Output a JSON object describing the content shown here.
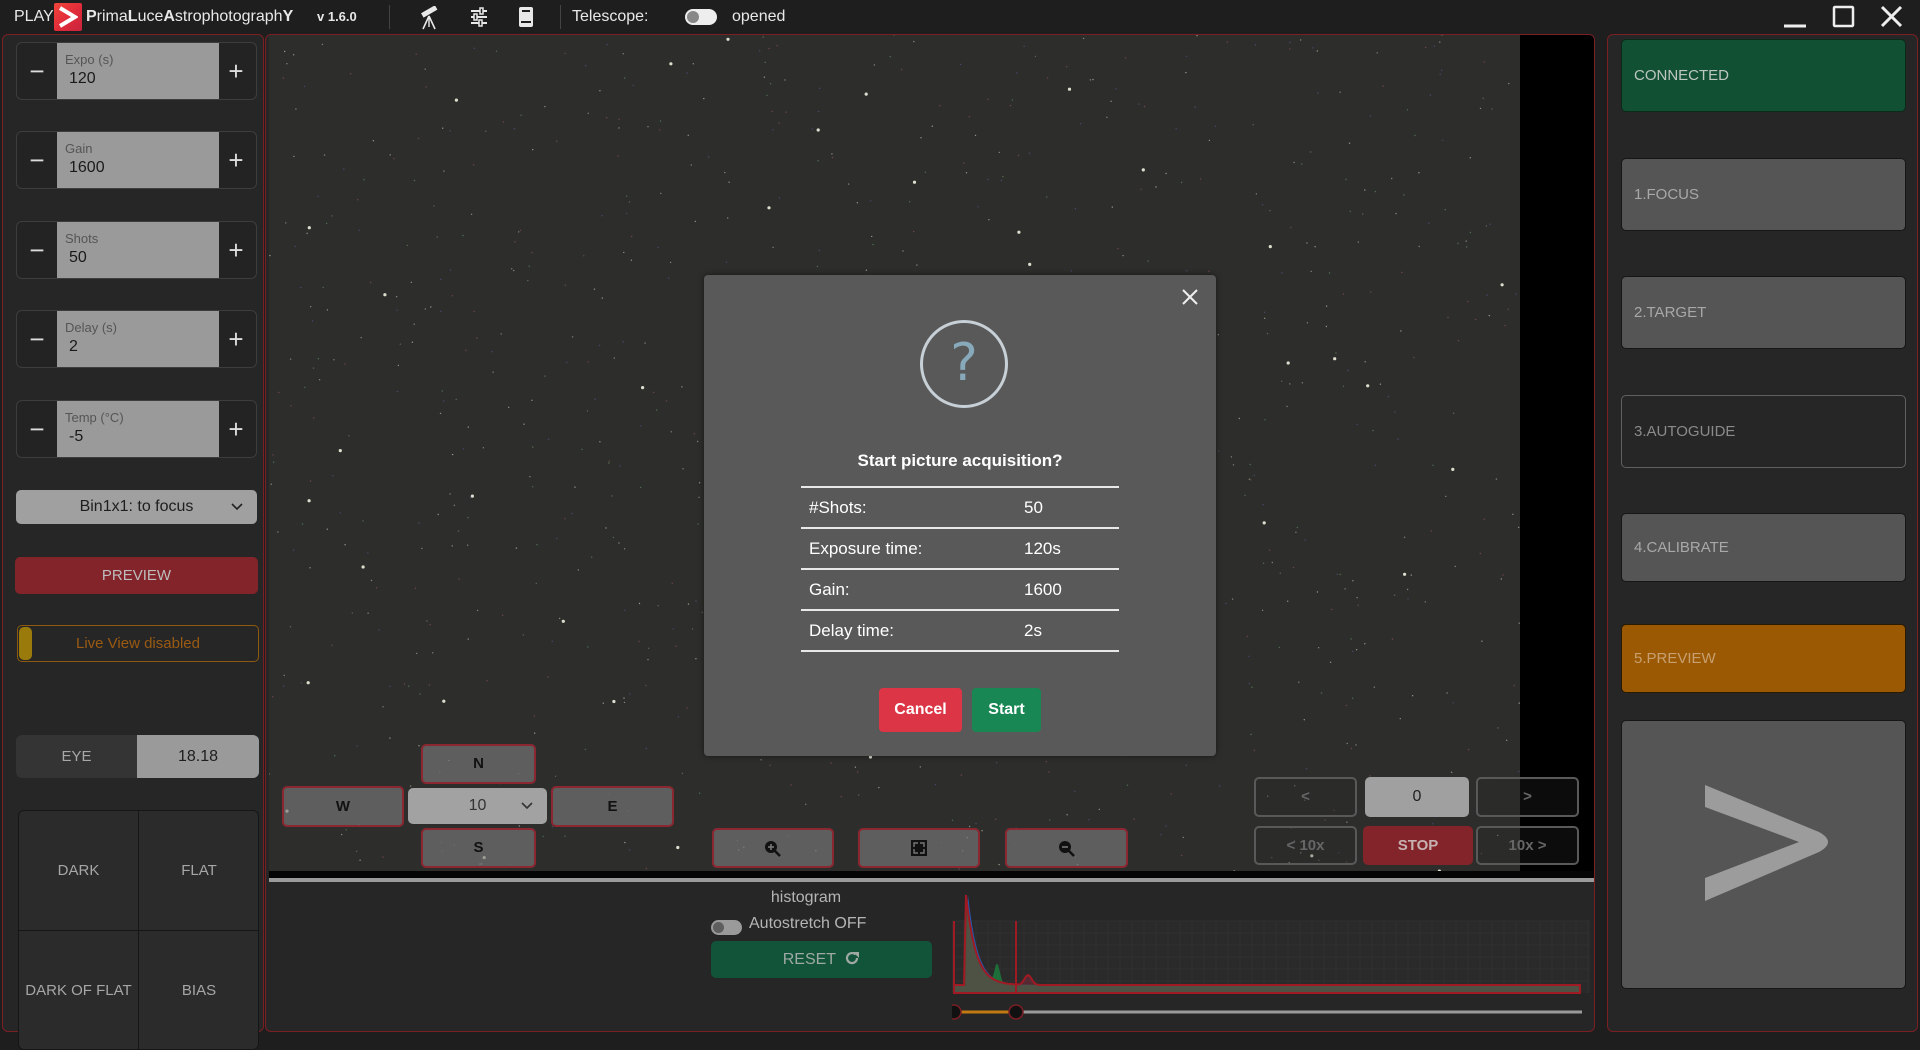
{
  "titlebar": {
    "play_label": "PLAY",
    "brand_parts": [
      "P",
      "rima",
      "L",
      "uce",
      "A",
      "strophotograph",
      "Y"
    ],
    "version": "v 1.6.0",
    "icons": [
      "telescope-icon",
      "sliders-icon",
      "book-icon"
    ],
    "telescope_label": "Telescope:",
    "telescope_status": "opened",
    "telescope_toggle_on": false,
    "window_controls": [
      "minimize-icon",
      "maximize-icon",
      "close-icon"
    ]
  },
  "left_panel": {
    "steppers": [
      {
        "label": "Expo (s)",
        "value": "120"
      },
      {
        "label": "Gain",
        "value": "1600"
      },
      {
        "label": "Shots",
        "value": "50"
      },
      {
        "label": "Delay (s)",
        "value": "2"
      },
      {
        "label": "Temp (°C)",
        "value": "-5"
      }
    ],
    "minus_symbol": "−",
    "plus_symbol": "+",
    "bin_select": {
      "selected": "Bin1x1: to focus"
    },
    "preview_button": "PREVIEW",
    "live_view": "Live View disabled",
    "eye": {
      "label": "EYE",
      "value": "18.18"
    },
    "calibration_frames": [
      "DARK",
      "FLAT",
      "DARK OF FLAT",
      "BIAS"
    ]
  },
  "main": {
    "direction_pad": {
      "north": "N",
      "south": "S",
      "west": "W",
      "east": "E",
      "step_select": {
        "selected": "10"
      }
    },
    "zoom_controls": [
      "zoom-in-icon",
      "fit-screen-icon",
      "zoom-out-icon"
    ],
    "frame_nav": {
      "prev": "<",
      "index": "0",
      "next": ">",
      "prev10": "< 10x",
      "stop": "STOP",
      "next10": "10x >"
    },
    "histogram": {
      "title": "histogram",
      "autostretch_label": "Autostretch OFF",
      "autostretch_on": false,
      "reset_button": "RESET",
      "black_point_fraction": 0.0,
      "white_point_fraction": 0.1,
      "colors": {
        "red": "#a01a24",
        "green": "#1b7a3c",
        "blue": "#1d5fc0",
        "slider_active": "#c27a12"
      }
    }
  },
  "dialog": {
    "title": "Start picture acquisition?",
    "rows": [
      {
        "label": "#Shots:",
        "value": "50"
      },
      {
        "label": "Exposure time:",
        "value": "120s"
      },
      {
        "label": "Gain:",
        "value": "1600"
      },
      {
        "label": "Delay time:",
        "value": "2s"
      }
    ],
    "icon": "?",
    "cancel_label": "Cancel",
    "start_label": "Start"
  },
  "right_panel": {
    "steps": [
      {
        "label": "CONNECTED",
        "state": "done"
      },
      {
        "label": "1.FOCUS",
        "state": "idle"
      },
      {
        "label": "2.TARGET",
        "state": "idle"
      },
      {
        "label": "3.AUTOGUIDE",
        "state": "disabled"
      },
      {
        "label": "4.CALIBRATE",
        "state": "idle"
      },
      {
        "label": "5.PREVIEW",
        "state": "active"
      }
    ],
    "next_icon": "chevron-right-icon"
  }
}
